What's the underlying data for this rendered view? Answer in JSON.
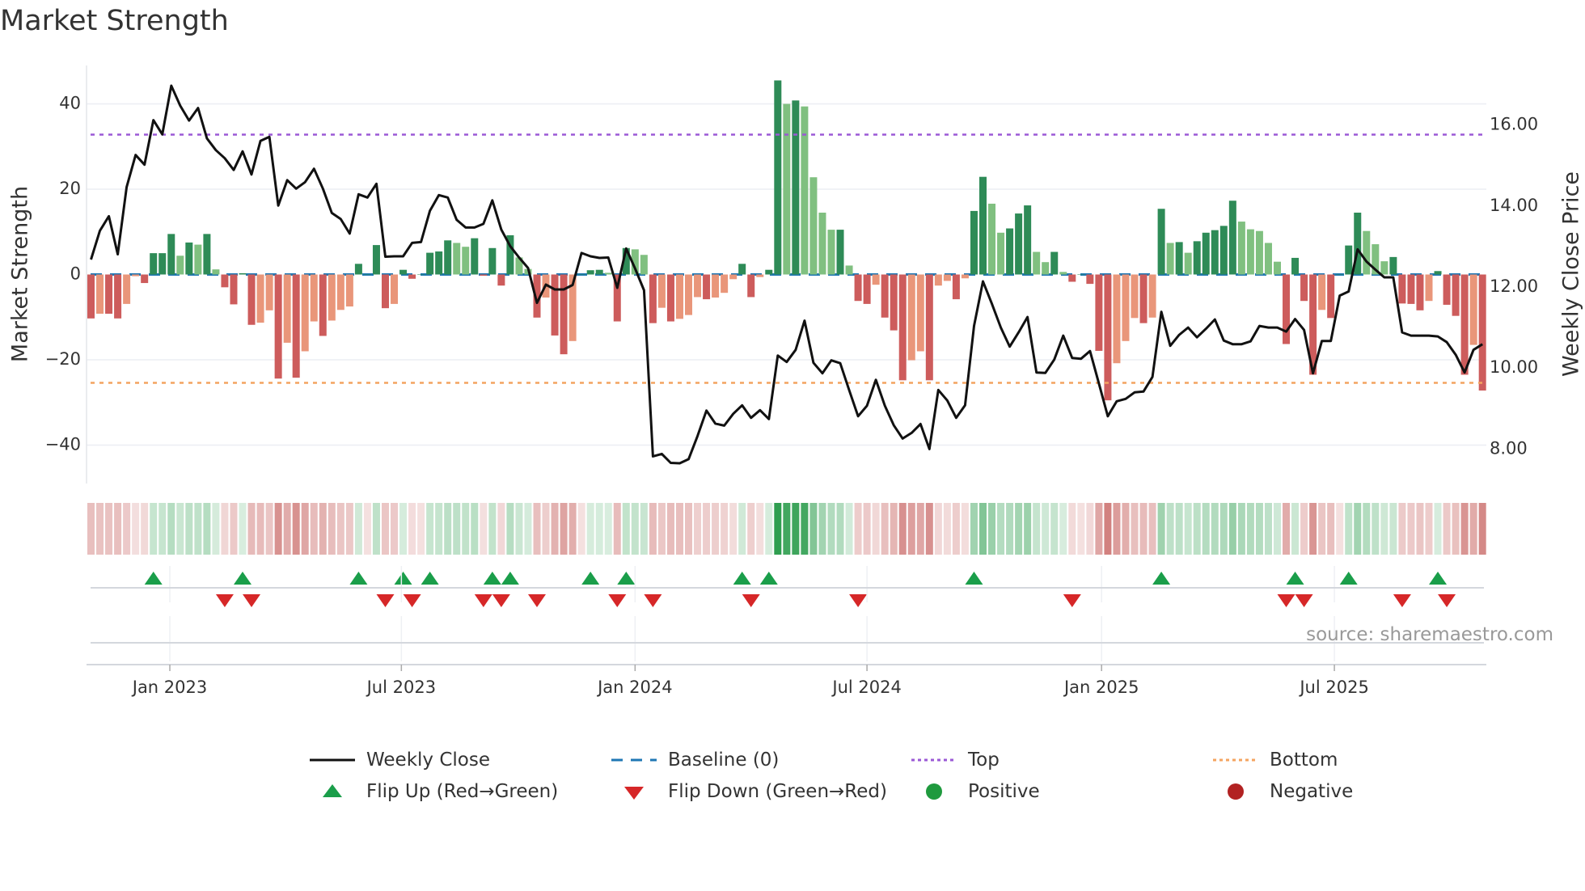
{
  "title": "Market Strength",
  "source": "source: sharemaestro.com",
  "colors": {
    "up_strong": "#2e8b57",
    "up_weak": "#80c080",
    "down_strong": "#cd5c5c",
    "down_weak": "#e9967a",
    "close_line": "#111111",
    "baseline": "#1f77b4",
    "top": "#9b59d6",
    "bottom": "#f4a460",
    "flip_up": "#1a9e4a",
    "flip_down": "#d62728",
    "positive": "#1f9a3e",
    "negative": "#b22222",
    "heat_pos": "#2e9e4f",
    "heat_neg": "#c0504d"
  },
  "legend": [
    {
      "label": "Weekly Close",
      "symbol": "line"
    },
    {
      "label": "Baseline (0)",
      "symbol": "dash"
    },
    {
      "label": "Top",
      "symbol": "dot-purple"
    },
    {
      "label": "Bottom",
      "symbol": "dot-orange"
    },
    {
      "label": "Flip Up (Red→Green)",
      "symbol": "tri-up"
    },
    {
      "label": "Flip Down (Green→Red)",
      "symbol": "tri-down"
    },
    {
      "label": "Positive",
      "symbol": "circle-green"
    },
    {
      "label": "Negative",
      "symbol": "circle-red"
    }
  ],
  "chart_data": {
    "type": "bar",
    "title": "Market Strength",
    "ylabel": "Market Strength",
    "y2label": "Weekly Close Price",
    "ylim": [
      -49,
      49
    ],
    "y2lim": [
      7.15,
      17.47
    ],
    "yticks": [
      40,
      20,
      0,
      -20,
      -40
    ],
    "ytick_labels": [
      "40",
      "20",
      "0",
      "−20",
      "−40"
    ],
    "y2ticks": [
      16,
      14,
      12,
      10,
      8
    ],
    "y2tick_labels": [
      "16.00",
      "14.00",
      "12.00",
      "10.00",
      "8.00"
    ],
    "x_unit": "week index (0 = first week, ~early Nov 2022)",
    "xticks": [
      8.84,
      34.8,
      61.0,
      87.0,
      113.3,
      139.4
    ],
    "xtick_labels": [
      "Jan 2023",
      "Jul 2023",
      "Jan 2024",
      "Jul 2024",
      "Jan 2025",
      "Jul 2025"
    ],
    "top_level": 32.8,
    "bottom_level": -25.4,
    "baseline": 0,
    "market_strength": [
      -10.3,
      -9.2,
      -9.2,
      -10.3,
      -6.9,
      -0.4,
      -2,
      5,
      5,
      9.5,
      4.4,
      7.5,
      7,
      9.5,
      1.2,
      -3,
      -7,
      0.3,
      -11.8,
      -11.3,
      -8.4,
      -24.4,
      -16,
      -24.2,
      -18,
      -11,
      -14.4,
      -10.8,
      -8.3,
      -7.5,
      2.5,
      0,
      6.9,
      -7.9,
      -6.9,
      1.1,
      -1,
      0,
      5.1,
      5.4,
      8,
      7.4,
      6.5,
      8.5,
      -0.3,
      6.2,
      -2.6,
      9.2,
      4,
      1.3,
      -10.1,
      -5.4,
      -14.3,
      -18.7,
      -15.6,
      0,
      1,
      1.1,
      0.4,
      -11,
      6.2,
      5.9,
      4.6,
      -11.4,
      -7.8,
      -11,
      -10.4,
      -9.5,
      -5.3,
      -5.8,
      -5.4,
      -4.3,
      -1.1,
      2.5,
      -5.3,
      -0.6,
      1.1,
      45.5,
      40,
      40.8,
      39.4,
      22.8,
      14.5,
      10.5,
      10.5,
      2.1,
      -6.2,
      -6.9,
      -2.4,
      -10.1,
      -13.1,
      -24.8,
      -20.1,
      -18,
      -24.8,
      -2.6,
      -1.5,
      -5.8,
      -0.9,
      14.9,
      22.9,
      16.6,
      9.8,
      10.8,
      14.3,
      16.2,
      5.3,
      2.9,
      5.3,
      0.6,
      -1.7,
      0,
      -2.2,
      -17.9,
      -29.5,
      -20.8,
      -15.6,
      -10.2,
      -11.4,
      -10.1,
      15.4,
      7.4,
      7.6,
      5.1,
      7.8,
      9.8,
      10.4,
      11.4,
      17.3,
      12.4,
      10.6,
      10.2,
      7.4,
      3,
      -16.3,
      3.9,
      -6.2,
      -23.5,
      -8.3,
      -10.2,
      0,
      6.8,
      14.5,
      10.2,
      7.1,
      3.1,
      4.1,
      -6.8,
      -6.9,
      -8.4,
      -6.2,
      0.8,
      -7.1,
      -9.7,
      -23.5,
      -16.5,
      -27.2
    ],
    "weekly_close": [
      12.68,
      13.39,
      13.75,
      12.81,
      14.47,
      15.26,
      15.02,
      16.12,
      15.77,
      16.97,
      16.48,
      16.11,
      16.42,
      15.67,
      15.38,
      15.18,
      14.89,
      15.35,
      14.78,
      15.61,
      15.71,
      14.01,
      14.64,
      14.43,
      14.59,
      14.92,
      14.43,
      13.83,
      13.68,
      13.32,
      14.29,
      14.21,
      14.55,
      12.75,
      12.76,
      12.76,
      13.09,
      13.11,
      13.88,
      14.27,
      14.21,
      13.66,
      13.47,
      13.47,
      13.56,
      14.14,
      13.42,
      13.01,
      12.73,
      12.47,
      11.61,
      12.06,
      11.94,
      11.94,
      12.05,
      12.84,
      12.76,
      12.72,
      12.73,
      11.98,
      12.95,
      12.46,
      11.92,
      7.82,
      7.88,
      7.66,
      7.65,
      7.75,
      8.32,
      8.95,
      8.63,
      8.58,
      8.87,
      9.08,
      8.77,
      8.96,
      8.74,
      10.31,
      10.15,
      10.45,
      11.17,
      10.13,
      9.87,
      10.19,
      10.12,
      9.46,
      8.81,
      9.07,
      9.71,
      9.07,
      8.59,
      8.26,
      8.4,
      8.62,
      8.0,
      9.46,
      9.2,
      8.77,
      9.08,
      11.04,
      12.14,
      11.59,
      11.0,
      10.53,
      10.88,
      11.26,
      9.89,
      9.88,
      10.21,
      10.8,
      10.25,
      10.23,
      10.42,
      9.62,
      8.81,
      9.18,
      9.24,
      9.4,
      9.42,
      9.78,
      11.39,
      10.55,
      10.82,
      11.0,
      10.76,
      10.97,
      11.2,
      10.68,
      10.59,
      10.59,
      10.66,
      11.04,
      11.0,
      11.0,
      10.9,
      11.21,
      10.94,
      9.87,
      10.67,
      10.67,
      11.79,
      11.89,
      12.93,
      12.63,
      12.43,
      12.24,
      12.24,
      10.88,
      10.8,
      10.8,
      10.8,
      10.78,
      10.64,
      10.33,
      9.89,
      10.45,
      10.59
    ],
    "flip_up_weeks": [
      7,
      17,
      30,
      35,
      38,
      45,
      47,
      56,
      60,
      73,
      76,
      99,
      120,
      135,
      141,
      151
    ],
    "flip_down_weeks": [
      15,
      18,
      33,
      36,
      44,
      46,
      50,
      59,
      63,
      74,
      86,
      110,
      134,
      136,
      147,
      152
    ],
    "grid": true,
    "legend_position": "bottom"
  }
}
